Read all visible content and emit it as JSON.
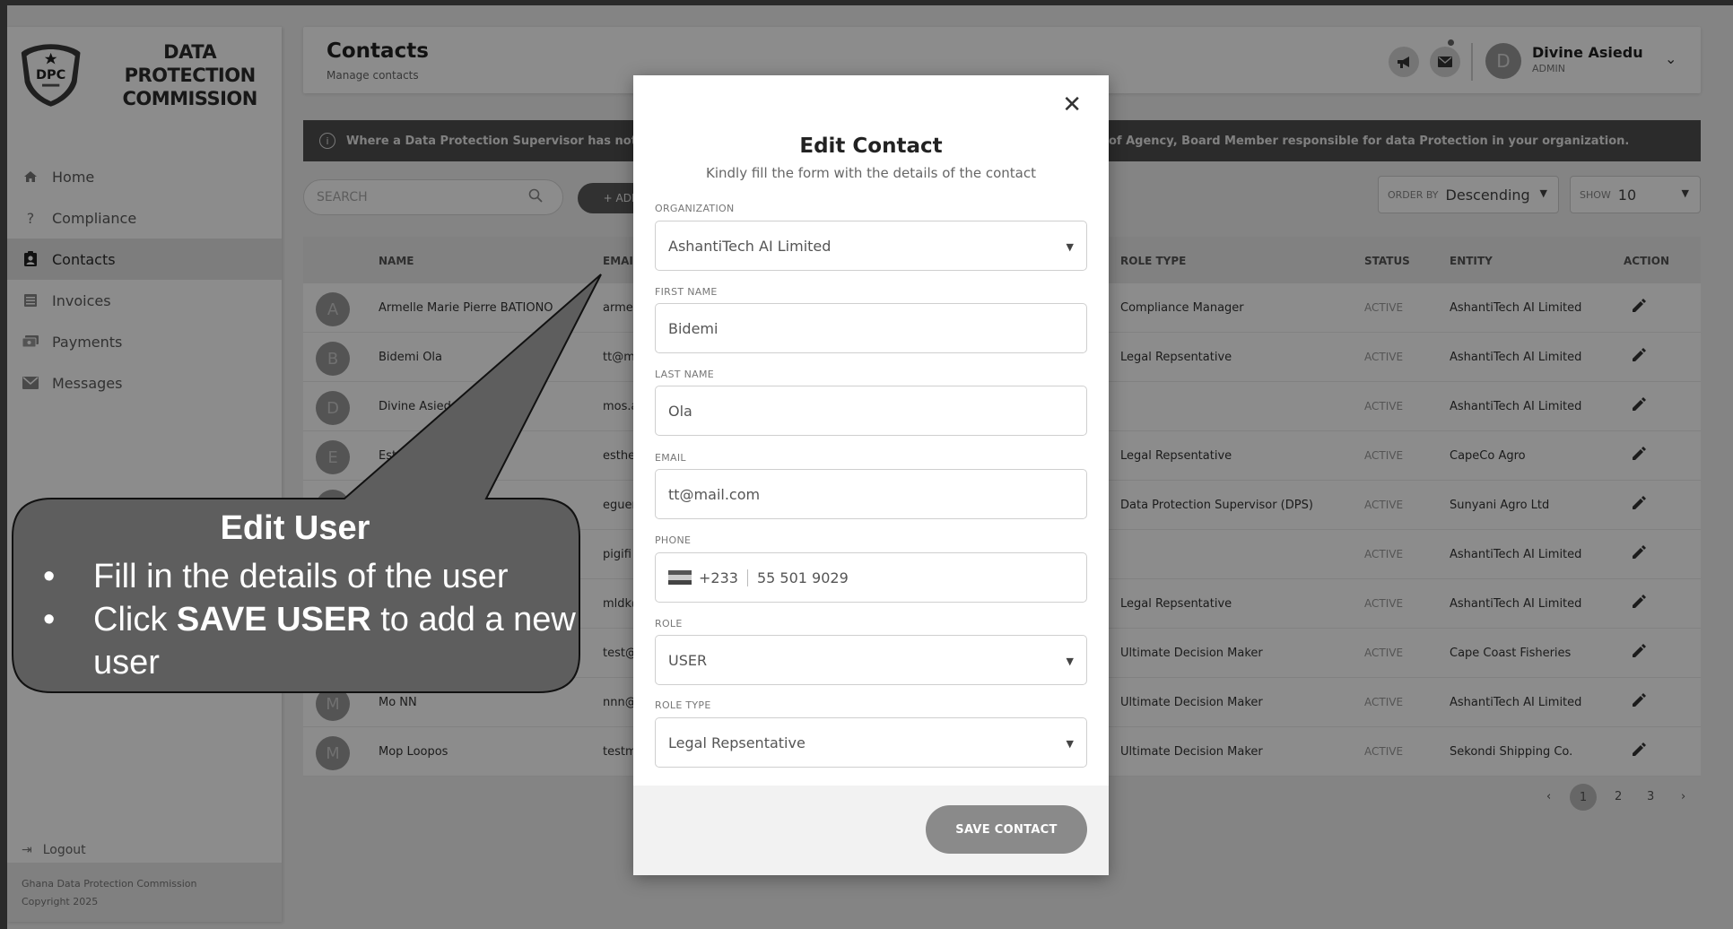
{
  "sidebar": {
    "logo_badge": "DPC",
    "logo_line1": "DATA PROTECTION",
    "logo_line2": "COMMISSION",
    "items": [
      {
        "label": "Home",
        "icon": "home-icon"
      },
      {
        "label": "Compliance",
        "icon": "question-icon"
      },
      {
        "label": "Contacts",
        "icon": "contact-card-icon"
      },
      {
        "label": "Invoices",
        "icon": "invoice-icon"
      },
      {
        "label": "Payments",
        "icon": "payment-icon"
      },
      {
        "label": "Messages",
        "icon": "mail-icon"
      }
    ],
    "logout": "Logout",
    "footer_line1": "Ghana Data Protection Commission",
    "footer_line2": "Copyright 2025"
  },
  "header": {
    "title": "Contacts",
    "subtitle": "Manage contacts",
    "user_initial": "D",
    "user_name": "Divine Asiedu",
    "user_role": "ADMIN"
  },
  "banner": {
    "left": "Where a Data Protection Supervisor has not yet bee",
    "right": "of Agency, Board Member responsible for data Protection in your organization."
  },
  "toolbar": {
    "search_placeholder": "SEARCH",
    "add_label": "+ ADD C",
    "order_by_label": "ORDER BY",
    "order_by_value": "Descending",
    "show_label": "SHOW",
    "show_value": "10"
  },
  "table": {
    "headers": {
      "name": "NAME",
      "email": "EMAI",
      "role_type": "ROLE TYPE",
      "status": "STATUS",
      "entity": "ENTITY",
      "action": "ACTION"
    },
    "rows": [
      {
        "initial": "A",
        "name": "Armelle Marie Pierre BATIONO",
        "email": "armel",
        "role_type": "Compliance Manager",
        "status": "ACTIVE",
        "entity": "AshantiTech AI Limited"
      },
      {
        "initial": "B",
        "name": "Bidemi Ola",
        "email": "tt@m",
        "role_type": "Legal Repsentative",
        "status": "ACTIVE",
        "entity": "AshantiTech AI Limited"
      },
      {
        "initial": "D",
        "name": "Divine Asiedu",
        "email": "mos.a",
        "role_type": "",
        "status": "ACTIVE",
        "entity": "AshantiTech AI Limited"
      },
      {
        "initial": "E",
        "name": "Est",
        "email": "esther",
        "role_type": "Legal Repsentative",
        "status": "ACTIVE",
        "entity": "CapeCo Agro"
      },
      {
        "initial": "",
        "name": "",
        "email": "eguer",
        "role_type": "Data Protection Supervisor (DPS)",
        "status": "ACTIVE",
        "entity": "Sunyani Agro Ltd"
      },
      {
        "initial": "",
        "name": "",
        "email": "pigifi",
        "role_type": "",
        "status": "ACTIVE",
        "entity": "AshantiTech AI Limited"
      },
      {
        "initial": "",
        "name": "",
        "email": "mldk@",
        "role_type": "Legal Repsentative",
        "status": "ACTIVE",
        "entity": "AshantiTech AI Limited"
      },
      {
        "initial": "",
        "name": "",
        "email": "test@",
        "role_type": "Ultimate Decision Maker",
        "status": "ACTIVE",
        "entity": "Cape Coast Fisheries"
      },
      {
        "initial": "M",
        "name": "Mo NN",
        "email": "nnn@",
        "role_type": "Ultimate Decision Maker",
        "status": "ACTIVE",
        "entity": "AshantiTech AI Limited"
      },
      {
        "initial": "M",
        "name": "Mop Loopos",
        "email": "testm",
        "role_type": "Ultimate Decision Maker",
        "status": "ACTIVE",
        "entity": "Sekondi Shipping Co."
      }
    ]
  },
  "pagination": {
    "prev": "‹",
    "pages": [
      "1",
      "2",
      "3"
    ],
    "next": "›"
  },
  "modal": {
    "title": "Edit Contact",
    "subtitle": "Kindly fill the form with the details of the contact",
    "organization_label": "ORGANIZATION",
    "organization_value": "AshantiTech AI Limited",
    "first_name_label": "FIRST NAME",
    "first_name_value": "Bidemi",
    "last_name_label": "LAST NAME",
    "last_name_value": "Ola",
    "email_label": "EMAIL",
    "email_value": "tt@mail.com",
    "phone_label": "PHONE",
    "phone_dial": "+233",
    "phone_value": "55 501 9029",
    "role_label": "ROLE",
    "role_value": "USER",
    "role_type_label": "ROLE TYPE",
    "role_type_value": "Legal Repsentative",
    "save_label": "SAVE CONTACT"
  },
  "callout": {
    "title": "Edit User",
    "item1": "Fill in the details of the user",
    "item2_prefix": "Click ",
    "item2_bold": "SAVE USER",
    "item2_suffix": " to add a new user"
  }
}
